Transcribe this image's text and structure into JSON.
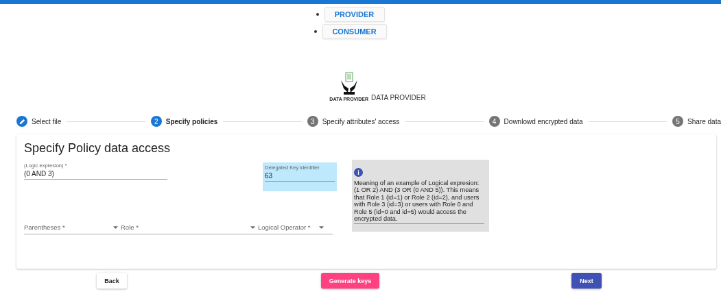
{
  "nav": [
    {
      "label": "PROVIDER"
    },
    {
      "label": "CONSUMER"
    }
  ],
  "logo": {
    "caption": "DATA PROVIDER",
    "title": "DATA PROVIDER"
  },
  "steps": [
    {
      "label": "Select file",
      "completed": true,
      "selected": false
    },
    {
      "label": "Specify policies",
      "completed": false,
      "selected": true,
      "number": "2"
    },
    {
      "label": "Specify attributes' access",
      "completed": false,
      "selected": false,
      "number": "3"
    },
    {
      "label": "Downlowd encrypted data",
      "completed": false,
      "selected": false,
      "number": "4"
    },
    {
      "label": "Share data",
      "completed": false,
      "selected": false,
      "number": "5"
    }
  ],
  "card": {
    "title": "Specify Policy data access",
    "logic": {
      "label": "(Logic expresion) *",
      "value": "(0 AND 3)"
    },
    "key": {
      "label": "Delegated Key identifier",
      "value": "63"
    },
    "info": {
      "icon": "i",
      "text": "Meaning of an example of Logical expresion: (1 OR 2) AND (3 OR (0 AND 5)). This means that Role 1 (id=1) or Role 2 (id=2), and users with Role 3 (id=3) or users with Role 0 and Role 5 (id=0 and id=5) would access the encrypted data."
    },
    "selects": [
      {
        "label": "Parentheses *"
      },
      {
        "label": "Role *"
      },
      {
        "label": "Logical Operator *"
      }
    ]
  },
  "buttons": [
    {
      "label": "Back",
      "kind": "plain"
    },
    {
      "label": "Generate keys",
      "kind": "pink"
    },
    {
      "label": "Next",
      "kind": "primary"
    }
  ]
}
